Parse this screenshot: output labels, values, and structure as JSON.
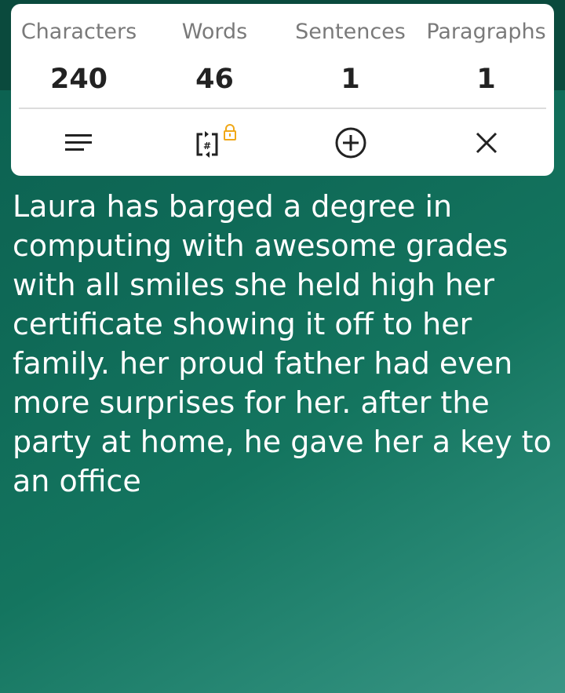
{
  "stats": [
    {
      "label": "Characters",
      "value": "240"
    },
    {
      "label": "Words",
      "value": "46"
    },
    {
      "label": "Sentences",
      "value": "1"
    },
    {
      "label": "Paragraphs",
      "value": "1"
    }
  ],
  "actions": {
    "icons": [
      "menu-icon",
      "hashtag-sync-icon",
      "lock-icon",
      "add-circle-icon",
      "close-icon"
    ],
    "lock_color": "#f0a818"
  },
  "text": "Laura has barged a degree in\ncomputing with awesome grades\nwith all smiles she held high her\ncertificate showing it off to her\nfamily. her proud father had even\nmore surprises for her. after the\nparty at home, he gave her a key to\nan office",
  "colors": {
    "background": "#0f6a57",
    "card": "#ffffff",
    "label": "#7a7a7a",
    "value": "#222222",
    "text": "#ffffff"
  }
}
